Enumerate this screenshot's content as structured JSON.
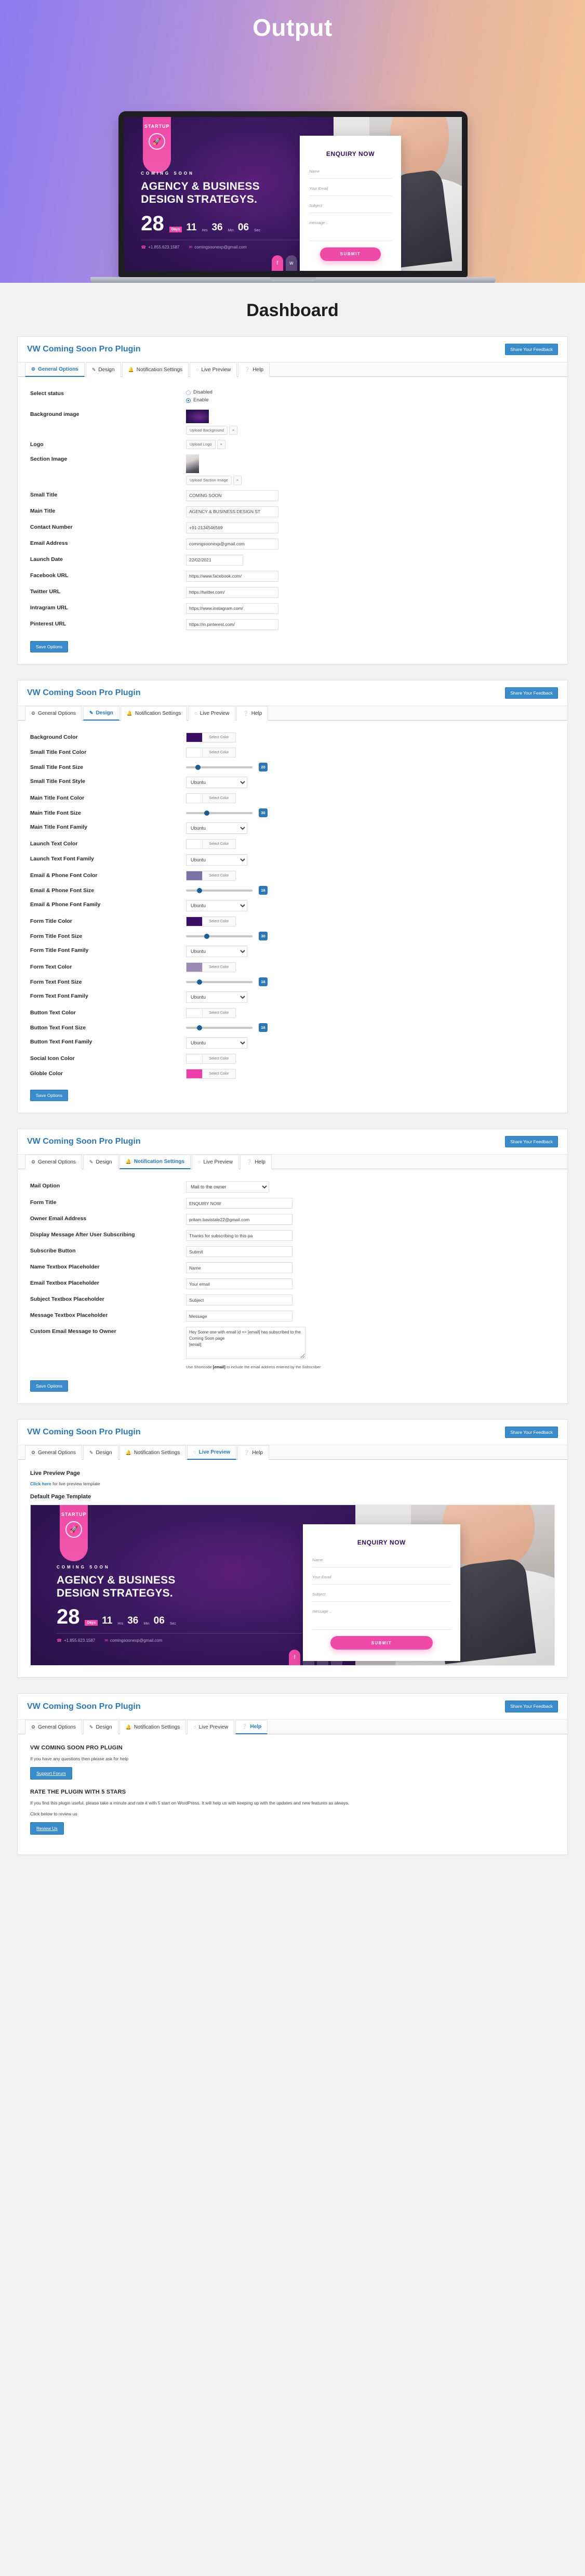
{
  "hero": {
    "title": "Output",
    "template": {
      "badge_text": "STARTUP",
      "badge_icon": "rocket-icon",
      "small_title": "COMING SOON",
      "main_title": "AGENCY & BUSINESS DESIGN STRATEGYS.",
      "countdown": [
        {
          "value": "28",
          "unit": "Days"
        },
        {
          "value": "11",
          "unit": "Hrs"
        },
        {
          "value": "36",
          "unit": "Min"
        },
        {
          "value": "06",
          "unit": "Sec"
        }
      ],
      "phone": "+1.855.623.1587",
      "email": "comingsoonexp@gmail.com",
      "form_title": "ENQUIRY NOW",
      "fields": [
        "Name",
        "Your Email",
        "Subject",
        "message .."
      ],
      "submit_label": "SUBMIT",
      "social": [
        "facebook-icon",
        "twitter-icon",
        "instagram-icon",
        "pinterest-icon"
      ]
    }
  },
  "page": {
    "title": "Dashboard"
  },
  "plugin": {
    "name": "VW Coming Soon Pro Plugin",
    "feedback_label": "Share Your Feedback"
  },
  "tabs": [
    {
      "label": "General Options",
      "icon": "gears-icon"
    },
    {
      "label": "Design",
      "icon": "pencil-square-icon"
    },
    {
      "label": "Notification Settings",
      "icon": "bell-icon"
    },
    {
      "label": "Live Preview",
      "icon": "spinner-icon"
    },
    {
      "label": "Help",
      "icon": "question-circle-icon"
    }
  ],
  "general": {
    "select_status": {
      "label": "Select status",
      "options": [
        "Disabled",
        "Enable"
      ],
      "selected": "Enable"
    },
    "background_image": {
      "label": "Background image",
      "upload_label": "Upload Background",
      "remove_label": "×"
    },
    "logo": {
      "label": "Logo",
      "upload_label": "Upload Logo",
      "remove_label": "×"
    },
    "section_image": {
      "label": "Section Image",
      "upload_label": "Upload Section Image",
      "remove_label": "×"
    },
    "fields": [
      {
        "label": "Small Title",
        "value": "COMING SOON"
      },
      {
        "label": "Main Title",
        "value": "AGENCY & BUSINESS DESIGN ST"
      },
      {
        "label": "Contact Number",
        "value": "+91-2134546569"
      },
      {
        "label": "Email Address",
        "value": "comingsoonexp@gmail.com"
      },
      {
        "label": "Launch Date",
        "value": "22/02/2021"
      },
      {
        "label": "Facebook URL",
        "value": "https://www.facebook.com/"
      },
      {
        "label": "Twitter URL",
        "value": "https://twitter.com/"
      },
      {
        "label": "Intragram URL",
        "value": "https://www.instagram.com/"
      },
      {
        "label": "Pinterest URL",
        "value": "https://in.pinterest.com/"
      }
    ],
    "save_label": "Save Options"
  },
  "design": {
    "select_color_label": "Select Color",
    "rows": [
      {
        "label": "Background Color",
        "type": "color",
        "color": "#3b0d63"
      },
      {
        "label": "Small Title Font Color",
        "type": "color",
        "color": "#ffffff"
      },
      {
        "label": "Small Title Font Size",
        "type": "slider",
        "value": "20",
        "pct": 18
      },
      {
        "label": "Small Title Font Style",
        "type": "select",
        "value": "Ubuntu"
      },
      {
        "label": "Main Title Font Color",
        "type": "color",
        "color": "#ffffff"
      },
      {
        "label": "Main Title Font Size",
        "type": "slider",
        "value": "30",
        "pct": 31
      },
      {
        "label": "Main Title Font Family",
        "type": "select",
        "value": "Ubuntu"
      },
      {
        "label": "Launch Text Color",
        "type": "color",
        "color": "#ffffff"
      },
      {
        "label": "Launch Text Font Family",
        "type": "select",
        "value": "Ubuntu"
      },
      {
        "label": "Email & Phone Font Color",
        "type": "color",
        "color": "#7b72a4"
      },
      {
        "label": "Email & Phone Font Size",
        "type": "slider",
        "value": "16",
        "pct": 20
      },
      {
        "label": "Email & Phone Font Family",
        "type": "select",
        "value": "Ubuntu"
      },
      {
        "label": "Form Title Color",
        "type": "color",
        "color": "#3b0d63"
      },
      {
        "label": "Form Title Font Size",
        "type": "slider",
        "value": "30",
        "pct": 31
      },
      {
        "label": "Form Title Font Family",
        "type": "select",
        "value": "Ubuntu"
      },
      {
        "label": "Form Text Color",
        "type": "color",
        "color": "#9b8ab5"
      },
      {
        "label": "Form Text Font Size",
        "type": "slider",
        "value": "16",
        "pct": 20
      },
      {
        "label": "Form Text Font Family",
        "type": "select",
        "value": "Ubuntu"
      },
      {
        "label": "Button Text Color",
        "type": "color",
        "color": "#ffffff"
      },
      {
        "label": "Button Text Font Size",
        "type": "slider",
        "value": "16",
        "pct": 20
      },
      {
        "label": "Button Text Font Family",
        "type": "select",
        "value": "Ubuntu"
      },
      {
        "label": "Social Icon Color",
        "type": "color",
        "color": "#ffffff"
      },
      {
        "label": "Globle Color",
        "type": "color",
        "color": "#ee3eaa"
      }
    ],
    "save_label": "Save Options"
  },
  "notification": {
    "mail_option": {
      "label": "Mail Option",
      "value": "Mail to the owner"
    },
    "fields": [
      {
        "label": "Form Title",
        "value": "ENQUIRY NOW"
      },
      {
        "label": "Owner Email Address",
        "value": "pritam.bavistale22@gmail.com"
      },
      {
        "label": "Display Message After User Subscribing",
        "value": "Thanks for subscribing to this pa"
      },
      {
        "label": "Subscribe Button",
        "value": "Submit"
      },
      {
        "label": "Name Textbox Placeholder",
        "value": "Name"
      },
      {
        "label": "Email Textbox Placeholder",
        "value": "Your email"
      },
      {
        "label": "Subject Textbox Placeholder",
        "value": "Subject"
      },
      {
        "label": "Message Textbox Placeholder",
        "value": "Message"
      }
    ],
    "custom_message": {
      "label": "Custom Email Message to Owner",
      "value": "Hey Some one with email id => [email] has subscribed to the Coming Soon page\n[email]",
      "hint_before": "Use Shortcode ",
      "hint_code": "[email]",
      "hint_after": " to include the email address entered by the Subscriber"
    },
    "save_label": "Save Options"
  },
  "live_preview": {
    "heading": "Live Preview Page",
    "link_text": "Click here",
    "link_suffix": " for live preview template",
    "subheading": "Default Page Template"
  },
  "help": {
    "heading": "VW COMING SOON PRO PLUGIN",
    "question_text": "If you have any questions then please ask for help",
    "support_label": "Support Forum",
    "rate_heading": "RATE THE PLUGIN WITH 5 STARS",
    "rate_text": "If you find this plugin useful, please take a minute and rate it with 5 start on WordPress. It will help us with keeping up with the updates and new features as always.",
    "review_text": "Click below to review us",
    "review_label": "Review Us"
  },
  "colors": {
    "accent": "#2e77b5",
    "button": "#3a8bc9",
    "brand_pink": "#ee3eaa",
    "brand_purple": "#3b0d63"
  }
}
